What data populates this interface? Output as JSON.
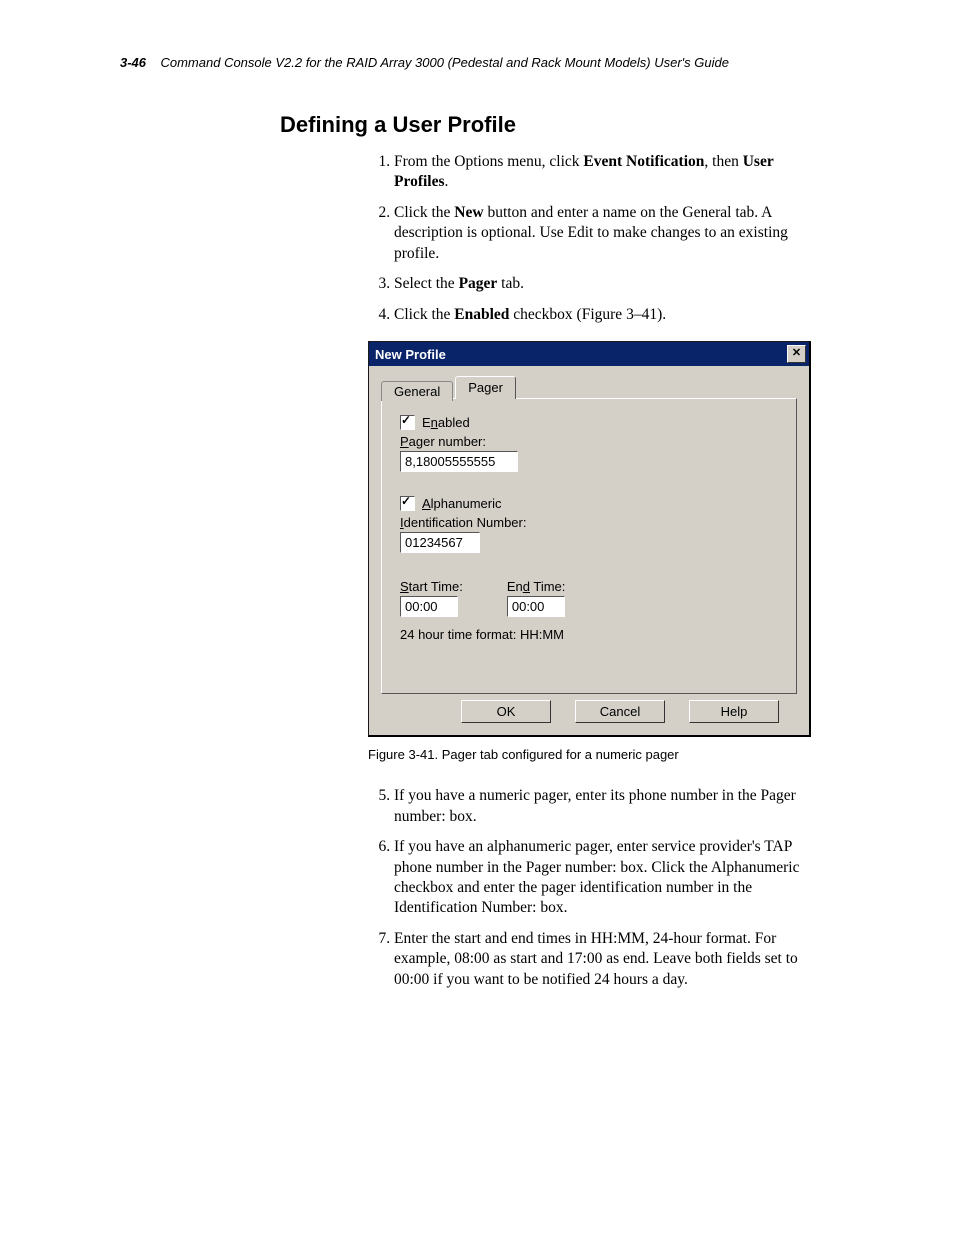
{
  "page_header": {
    "page_number": "3-46",
    "title": "Command Console V2.2 for the RAID Array 3000 (Pedestal and Rack Mount Models) User's Guide"
  },
  "section": {
    "heading": "Defining a User Profile",
    "steps_top": [
      {
        "prefix": "From the Options menu, click ",
        "bold1": "Event Notification",
        "mid": ", then ",
        "bold2": "User Profiles",
        "suffix": "."
      },
      {
        "prefix": "Click the ",
        "bold1": "New",
        "mid": " button and enter a name on the General tab. A description is optional. Use Edit to make changes to an existing profile.",
        "bold2": "",
        "suffix": ""
      },
      {
        "prefix": "Select the ",
        "bold1": "Pager",
        "mid": " tab.",
        "bold2": "",
        "suffix": ""
      },
      {
        "prefix": "Click the ",
        "bold1": "Enabled",
        "mid": " checkbox (Figure 3–41).",
        "bold2": "",
        "suffix": ""
      }
    ],
    "figure_caption": "Figure 3-41.  Pager tab configured for a numeric pager",
    "steps_bottom": [
      "If you have a numeric pager, enter its phone number in the Pager number: box.",
      "If you have an alphanumeric pager, enter service provider's TAP phone number in the Pager number: box. Click the Alphanumeric checkbox and enter the pager identification number in the Identification Number: box.",
      "Enter the start and end times in HH:MM, 24-hour format. For example, 08:00 as start and 17:00 as end. Leave both fields set to 00:00 if you want to be notified 24 hours a day."
    ]
  },
  "dialog": {
    "title": "New Profile",
    "tabs": {
      "general": "General",
      "pager": "Pager"
    },
    "enabled_label_pre": "E",
    "enabled_label_under": "n",
    "enabled_label_post": "abled",
    "pager_number_label_under": "P",
    "pager_number_label_post": "ager number:",
    "pager_number_value": "8,18005555555",
    "alpha_label_under": "A",
    "alpha_label_post": "lphanumeric",
    "id_label_under": "I",
    "id_label_post": "dentification Number:",
    "id_value": "01234567",
    "start_label_under": "S",
    "start_label_post": "tart Time:",
    "start_value": "00:00",
    "end_label_pre": "En",
    "end_label_under": "d",
    "end_label_post": " Time:",
    "end_value": "00:00",
    "format_hint": "24 hour time format: HH:MM",
    "buttons": {
      "ok": "OK",
      "cancel": "Cancel",
      "help": "Help"
    }
  }
}
